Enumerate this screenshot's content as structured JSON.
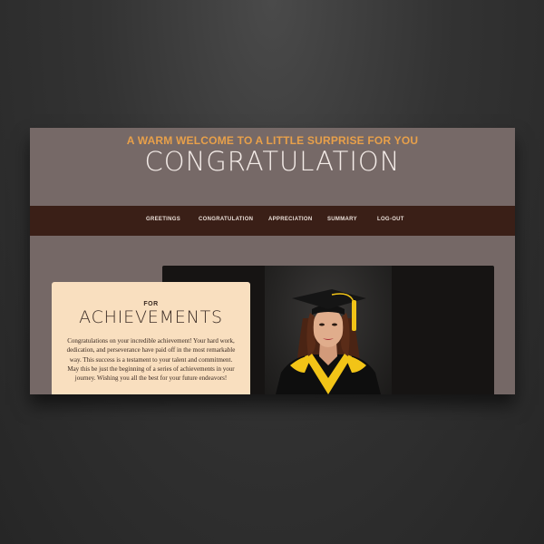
{
  "header": {
    "tagline": "A WARM WELCOME TO A LITTLE SURPRISE FOR YOU",
    "title": "CONGRATULATION"
  },
  "nav": {
    "items": [
      {
        "label": "GREETINGS"
      },
      {
        "label": "CONGRATULATION"
      },
      {
        "label": "APPRECIATION"
      },
      {
        "label": "SUMMARY"
      },
      {
        "label": "LOG-OUT"
      }
    ]
  },
  "card": {
    "kicker": "FOR",
    "title": "ACHIEVEMENTS",
    "text": "Congratulations on your incredible achievement! Your hard work, dedication, and perseverance have paid off in the most remarkable way. This success is a testament to your talent and commitment. May this be just the beginning of a series of achievements in your journey. Wishing you all the best for your future endeavors!"
  },
  "colors": {
    "accent": "#e8a04a",
    "header_bg": "#766967",
    "nav_bg": "#3a1f17",
    "card_bg": "#f9dfbf",
    "photo_panel_bg": "#161413",
    "gown_trim": "#f2c417"
  }
}
